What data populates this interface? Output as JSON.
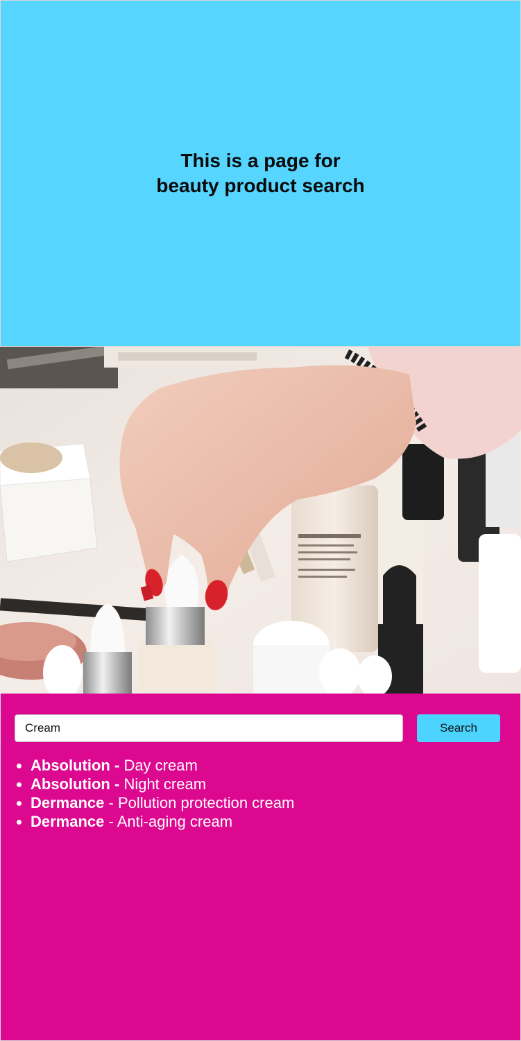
{
  "hero": {
    "title_line1": "This is a page for",
    "title_line2": "beauty product search",
    "background": "#56d6ff"
  },
  "photo": {
    "icon": "beauty-products-photo"
  },
  "search": {
    "value": "Cream",
    "placeholder": "",
    "button_label": "Search",
    "background": "#dd0890",
    "button_color": "#4cd4ff"
  },
  "results": [
    {
      "brand": "Absolution -",
      "sep": " ",
      "product": "Day cream"
    },
    {
      "brand": "Absolution -",
      "sep": " ",
      "product": "Night cream"
    },
    {
      "brand": "Dermance",
      "sep": " - ",
      "product": "Pollution protection cream"
    },
    {
      "brand": "Dermance",
      "sep": " - ",
      "product": "Anti-aging cream"
    }
  ]
}
